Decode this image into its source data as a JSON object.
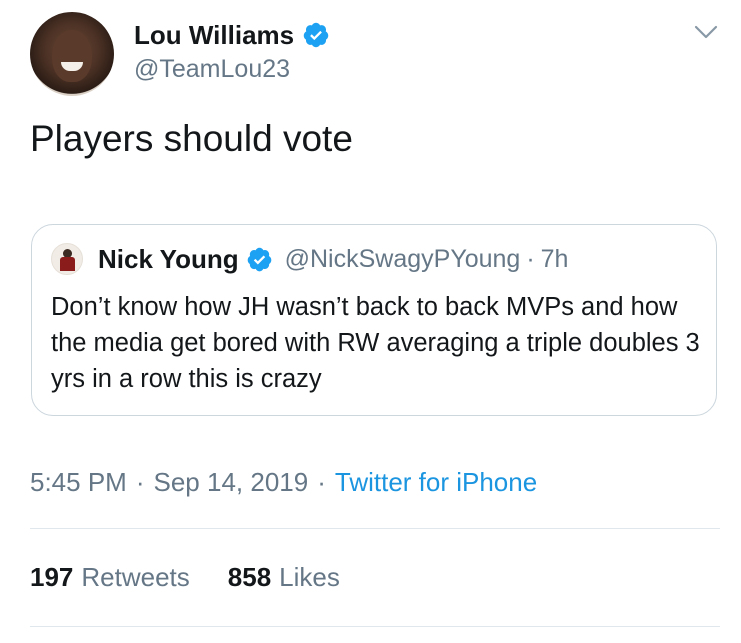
{
  "author": {
    "display_name": "Lou Williams",
    "handle": "@TeamLou23",
    "verified": true
  },
  "tweet": {
    "text": "Players should vote"
  },
  "quoted_tweet": {
    "display_name": "Nick Young",
    "handle": "@NickSwagyPYoung",
    "separator": "·",
    "time": "7h",
    "verified": true,
    "text": "Don’t know how JH wasn’t back to back MVPs and how the media get bored with RW averaging a triple doubles 3 yrs in a row this is crazy"
  },
  "meta": {
    "time": "5:45 PM",
    "separator_1": "·",
    "date": "Sep 14, 2019",
    "separator_2": "·",
    "source": "Twitter for iPhone"
  },
  "stats": {
    "retweets_count": "197",
    "retweets_label": "Retweets",
    "likes_count": "858",
    "likes_label": "Likes"
  },
  "icons": {
    "verified": "verified-badge-icon",
    "menu": "chevron-down-icon"
  },
  "colors": {
    "verified_blue": "#1da1f2",
    "link_blue": "#1b95e0",
    "secondary_text": "#657786",
    "border": "#ccd6dd"
  }
}
